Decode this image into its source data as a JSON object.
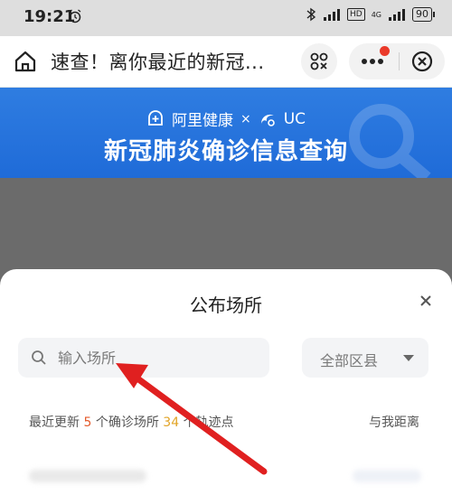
{
  "status_bar": {
    "time": "19:21",
    "alarm_icon": "alarm-clock-icon",
    "hd": "HD",
    "network": "4G",
    "battery": "90"
  },
  "title_bar": {
    "title": "速查！离你最近的新冠...",
    "home_icon": "home-icon",
    "scan_icon": "scan-icon",
    "more_icon": "more-dots-icon",
    "close_icon": "close-circle-icon"
  },
  "banner": {
    "brand_left": "阿里健康",
    "separator": "×",
    "brand_right": "UC",
    "title": "新冠肺炎确诊信息查询",
    "color": "#2a76df"
  },
  "sheet": {
    "title": "公布场所",
    "search": {
      "placeholder": "输入场所"
    },
    "district": {
      "label": "全部区县"
    },
    "stats": {
      "prefix": "最近更新",
      "venue_count": "5",
      "venue_text": "个确诊场所",
      "track_count": "34",
      "track_text": "个轨迹点"
    },
    "distance_label": "与我距离"
  },
  "colors": {
    "accent_orange": "#e45a2b",
    "accent_yellow": "#e2a427",
    "annotation_red": "#e02020"
  }
}
